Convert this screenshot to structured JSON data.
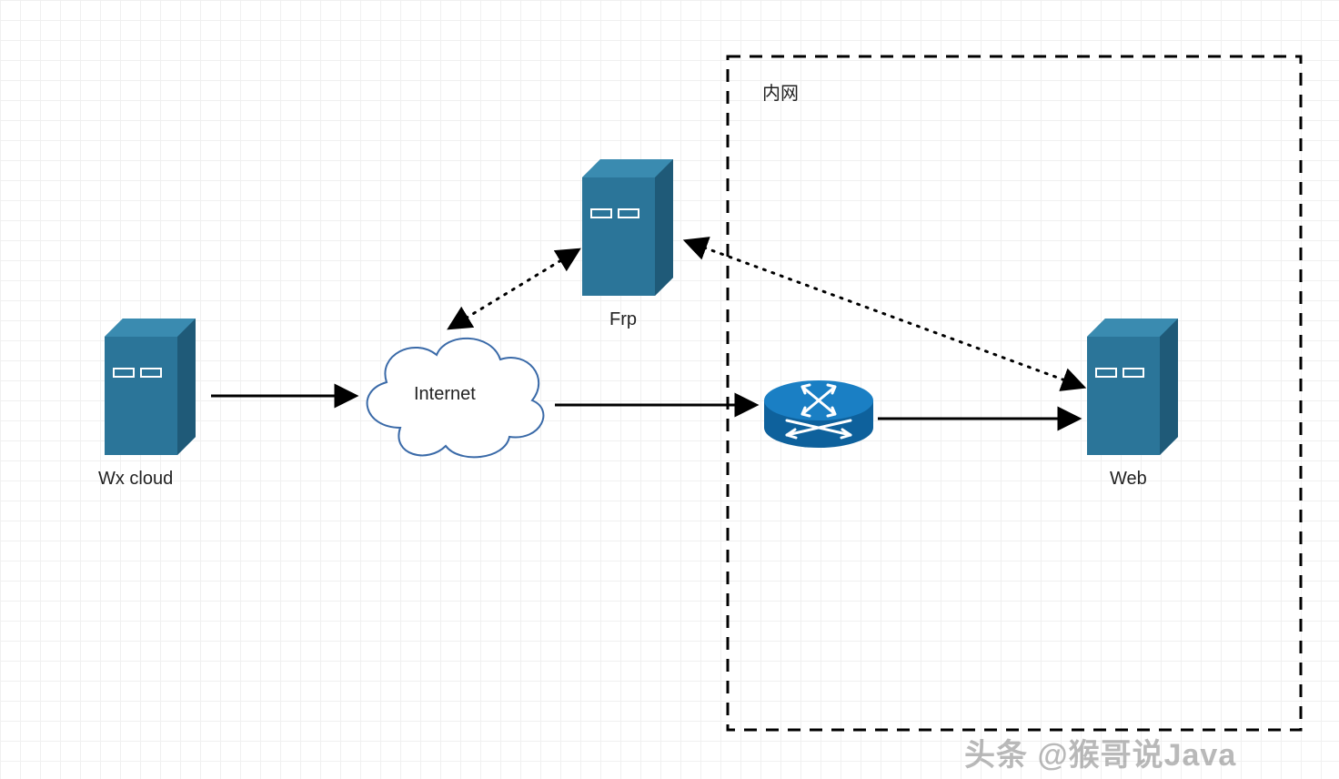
{
  "diagram": {
    "intranet_label": "内网",
    "nodes": {
      "wx_cloud": {
        "label": "Wx cloud"
      },
      "internet": {
        "label": "Internet"
      },
      "frp": {
        "label": "Frp"
      },
      "router": {
        "label": ""
      },
      "web": {
        "label": "Web"
      }
    },
    "edges": [
      {
        "from": "wx_cloud",
        "to": "internet",
        "style": "solid",
        "dir": "one"
      },
      {
        "from": "internet",
        "to": "router",
        "style": "solid",
        "dir": "one"
      },
      {
        "from": "router",
        "to": "web",
        "style": "solid",
        "dir": "one"
      },
      {
        "from": "internet",
        "to": "frp",
        "style": "dotted",
        "dir": "both"
      },
      {
        "from": "frp",
        "to": "web",
        "style": "dotted",
        "dir": "both"
      }
    ],
    "colors": {
      "server_fill": "#2b7599",
      "server_top": "#3a8bb0",
      "server_side": "#1f5a78",
      "router_fill": "#1273b8",
      "arrow": "#000000",
      "cloud_stroke": "#3a6aa8",
      "intranet_border": "#000000"
    }
  },
  "watermark": "头条 @猴哥说Java"
}
